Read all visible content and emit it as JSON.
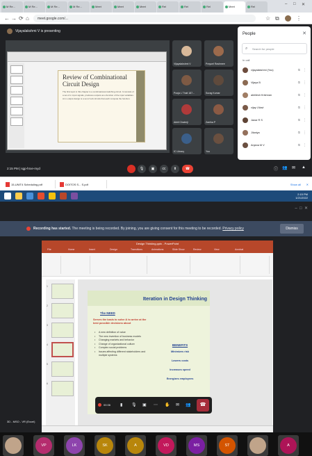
{
  "browser": {
    "tabs": [
      "M Re...",
      "M Re...",
      "M Re...",
      "M Re...",
      "Meet",
      "Meet",
      "Meet",
      "Rel",
      "Rel",
      "Rel",
      "Meet",
      "Rel"
    ],
    "url": "meet.google.com/..."
  },
  "meet_top": {
    "presenter_label": "Vijayalakshmi V is presenting",
    "slide_title": "Review of Combinational Circuit Design",
    "slide_body": "The first topic in this chapter is a combinational switching circuit. It consists of a set of m input signals, produces outputs as a function of the input variables. An n-output design is a set of sub circuits that each compute the function.",
    "tiles": [
      {
        "name": "Vijayalakshmi V"
      },
      {
        "name": "Prayuel Rashmee"
      },
      {
        "name": "Pooja L Thali 187..."
      },
      {
        "name": "Surag Kumar"
      },
      {
        "name": "Akhil Chaterji"
      },
      {
        "name": "Zarrika P"
      },
      {
        "name": "IC Library"
      },
      {
        "name": "You"
      }
    ],
    "time": "2:15 PM | sgp-hrxe-myd",
    "people_title": "People",
    "search_placeholder": "Search for people",
    "in_call_label": "In call",
    "people": [
      {
        "name": "vijayalakshmi (You)",
        "color": "#6d4c3d"
      },
      {
        "name": "Vijaya B",
        "color": "#8b6a52"
      },
      {
        "name": "akhilesh Krishnan",
        "color": "#a07d64"
      },
      {
        "name": "vijay LNavi",
        "color": "#7a5a48"
      },
      {
        "name": "Janar R S",
        "color": "#5f4435"
      },
      {
        "name": "Jilaniya",
        "color": "#93705b"
      },
      {
        "name": "Anjana M V",
        "color": "#6a4f40"
      }
    ]
  },
  "downloads": {
    "items": [
      "15-UNIT4 Scheduling.pdf",
      "DOITOS S... S.pdf"
    ],
    "show_all": "Show all"
  },
  "tray": {
    "time": "2:15 PM",
    "date": "1/21/2022"
  },
  "recording": {
    "banner_bold": "Recording has started.",
    "banner_text": " The meeting is being recorded. By joining, you are giving consent for this meeting to be recorded. ",
    "banner_link": "Privacy policy",
    "dismiss": "Dismiss"
  },
  "ppt": {
    "title": "Design Thinking.pptx - PowerPoint",
    "tabs": [
      "File",
      "Home",
      "Insert",
      "Design",
      "Transitions",
      "Animations",
      "Slide Show",
      "Review",
      "View",
      "Acrobat"
    ],
    "slide_title": "Iteration in Design Thinking",
    "need_heading": "The NEED",
    "need_sub": "Serves the basis to solve & to arrive at the best possible decisions about",
    "bullets": [
      "A new definition of value",
      "The new invention of business models",
      "Changing markets and behavior",
      "Change of organizational culture",
      "Complex social problems",
      "Issues affecting different stakeholders and multiple systems"
    ],
    "benefits_heading": "BENEFITS",
    "benefits": [
      "Minimizes risk",
      "Lowers costs",
      "Increases speed",
      "Energizes employees"
    ]
  },
  "controls2": {
    "timer": "00:36",
    "cam_label": "3D - MSO - VR (Excel)"
  },
  "participants_strip": [
    {
      "initials": "",
      "color": "#c0a48a"
    },
    {
      "initials": "VP",
      "color": "#b52c6e"
    },
    {
      "initials": "LK",
      "color": "#8e44ad"
    },
    {
      "initials": "SK",
      "color": "#b8860b"
    },
    {
      "initials": "A",
      "color": "#b8860b"
    },
    {
      "initials": "VD",
      "color": "#c2185b"
    },
    {
      "initials": "MS",
      "color": "#7b1fa2"
    },
    {
      "initials": "ST",
      "color": "#d35400"
    },
    {
      "initials": "",
      "color": "#c0a48a"
    },
    {
      "initials": "A",
      "color": "#ad1457"
    }
  ]
}
